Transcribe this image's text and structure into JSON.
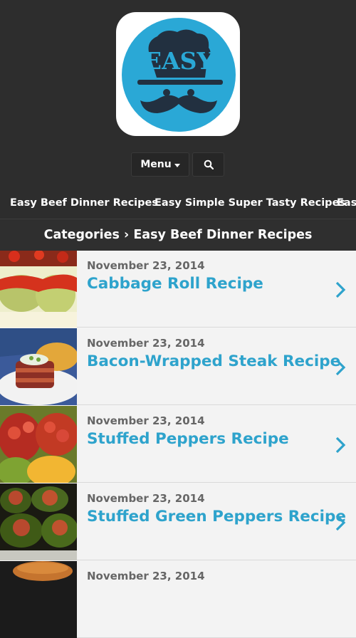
{
  "logo": {
    "text": "EASY",
    "bg_color": "#2aa8d6"
  },
  "nav": {
    "menu_label": "Menu",
    "search_icon": "search-icon"
  },
  "categories": [
    "Easy Beef Dinner Recipes",
    "Easy Simple Super Tasty Recipes",
    "Easy"
  ],
  "breadcrumb": "Categories › Easy Beef Dinner Recipes",
  "posts": [
    {
      "date": "November 23, 2014",
      "title": "Cabbage Roll Recipe"
    },
    {
      "date": "November 23, 2014",
      "title": "Bacon-Wrapped Steak Recipe"
    },
    {
      "date": "November 23, 2014",
      "title": "Stuffed Peppers Recipe"
    },
    {
      "date": "November 23, 2014",
      "title": "Stuffed Green Peppers Recipe"
    },
    {
      "date": "November 23, 2014",
      "title": ""
    }
  ],
  "colors": {
    "accent": "#2ea3cc",
    "header_bg": "#2d2d2d",
    "list_bg": "#f3f3f3",
    "date": "#666666"
  }
}
